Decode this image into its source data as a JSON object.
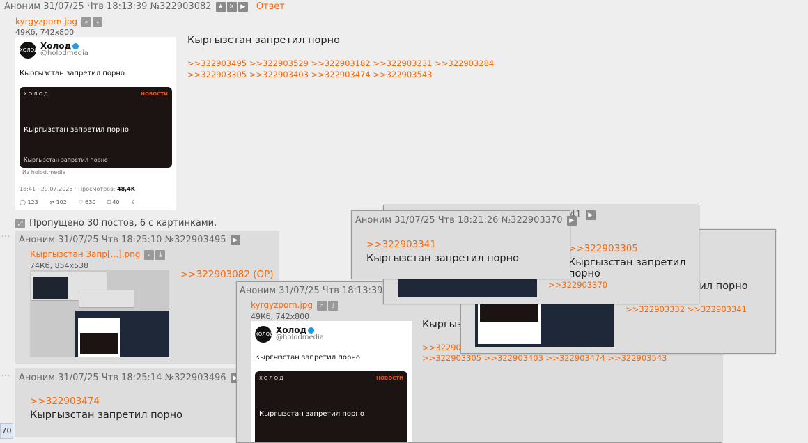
{
  "op": {
    "author": "Аноним",
    "date": "31/07/25 Чтв 18:13:39",
    "num": "№322903082",
    "reply_label": "Ответ",
    "file_name": "kyrgyzporn.jpg",
    "file_meta": "49Кб, 742x800",
    "text": "Кыргызстан запретил порно",
    "replies_line1": ">>322903495 >>322903529 >>322903182 >>322903231 >>322903284",
    "replies_line2": ">>322903305 >>322903403 >>322903474 >>322903543"
  },
  "tweet": {
    "name": "Холод",
    "handle": "@holodmedia",
    "text": "Кыргызстан запретил порно",
    "card_brand": "ХОЛОД",
    "card_tag": "НОВОСТИ",
    "card_title": "Кыргызстан запретил порно",
    "card_caption": "Кыргызстан запретил порно",
    "source": "Из holod.media",
    "timestamp": "18:41 · 29.07.2025 · Просмотров: ",
    "views": "48,4K",
    "replies": "123",
    "retweets": "102",
    "likes": "630",
    "bookmarks": "40"
  },
  "skipped": "Пропущено 30 постов, 6 с картинками.",
  "post2": {
    "author": "Аноним",
    "date": "31/07/25 Чтв 18:25:10",
    "num": "№322903495",
    "file_name": "Кыргызстан Запр[...].png",
    "file_meta": "74Кб, 854x538",
    "reply": ">>322903082 (OP)"
  },
  "post3": {
    "author": "Аноним",
    "date": "31/07/25 Чтв 18:25:14",
    "num": "№322903496",
    "reply": ">>322903474",
    "text": "Кыргызстан запретил порно"
  },
  "popup_op": {
    "author": "Аноним",
    "date": "31/07/25 Чтв 18:13:39",
    "file_name": "kyrgyzporn.jpg",
    "file_meta": "49Кб, 742x800",
    "text_partial": "Кыргызс",
    "replies_line1": ">>32290334",
    "replies_line2": ">>322903305 >>322903403 >>322903474 >>322903543"
  },
  "popup_a": {
    "num_fragment": "41",
    "replies": ">>322903370"
  },
  "popup_b": {
    "reply": ">>322903305",
    "text": "Кыргызстан запретил порно",
    "op_fragment": "P)",
    "text2": "етил порно",
    "replies": ">>322903332 >>322903341"
  },
  "popup_top": {
    "author": "Аноним",
    "date": "31/07/25 Чтв 18:21:26",
    "num": "№322903370",
    "reply": ">>322903341",
    "text": "Кыргызстан запретил порно"
  },
  "page_counter": "70"
}
